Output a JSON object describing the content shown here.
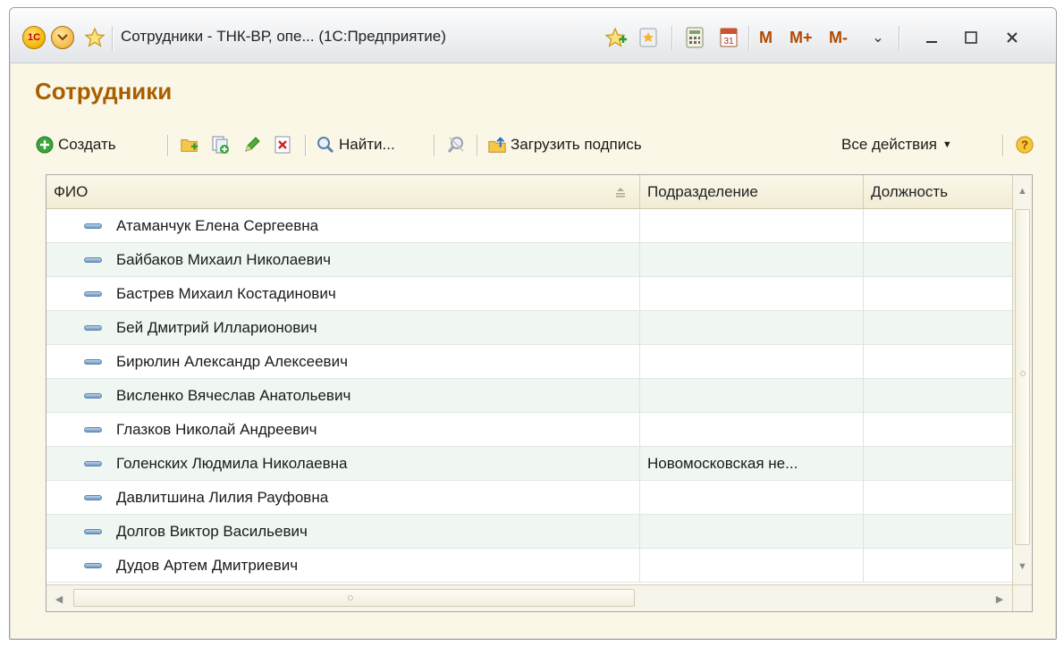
{
  "window": {
    "title": "Сотрудники - ТНК-ВР, опе...  (1С:Предприятие)",
    "logo_text": "1С",
    "memory_buttons": [
      "M",
      "M+",
      "M-"
    ]
  },
  "form": {
    "title": "Сотрудники"
  },
  "toolbar": {
    "create_label": "Создать",
    "find_label": "Найти...",
    "load_signature_label": "Загрузить подпись",
    "all_actions_label": "Все действия"
  },
  "table": {
    "columns": [
      "ФИО",
      "Подразделение",
      "Должность"
    ],
    "rows": [
      {
        "fio": "Атаманчук Елена Сергеевна",
        "department": "",
        "position": ""
      },
      {
        "fio": "Байбаков Михаил Николаевич",
        "department": "",
        "position": ""
      },
      {
        "fio": "Бастрев Михаил Костадинович",
        "department": "",
        "position": ""
      },
      {
        "fio": "Бей Дмитрий Илларионович",
        "department": "",
        "position": ""
      },
      {
        "fio": "Бирюлин Александр Алексеевич",
        "department": "",
        "position": ""
      },
      {
        "fio": "Висленко Вячеслав Анатольевич",
        "department": "",
        "position": ""
      },
      {
        "fio": "Глазков Николай Андреевич",
        "department": "",
        "position": ""
      },
      {
        "fio": "Голенских Людмила Николаевна",
        "department": "Новомосковская не...",
        "position": ""
      },
      {
        "fio": "Давлитшина Лилия Рауфовна",
        "department": "",
        "position": ""
      },
      {
        "fio": "Долгов Виктор Васильевич",
        "department": "",
        "position": ""
      },
      {
        "fio": "Дудов Артем Дмитриевич",
        "department": "",
        "position": ""
      }
    ]
  },
  "icons": {
    "create": "plus-circle-icon",
    "add_folder": "add-folder-icon",
    "copy": "copy-icon",
    "edit": "pencil-icon",
    "delete": "delete-icon",
    "find": "magnifier-icon",
    "cancel_search": "cancel-search-icon",
    "load": "load-signature-icon",
    "help": "help-icon"
  },
  "colors": {
    "form_title": "#a85e00",
    "window_bg": "#fbf7e6",
    "row_alt": "#f0f6f1",
    "accent_green": "#3aa53a"
  }
}
